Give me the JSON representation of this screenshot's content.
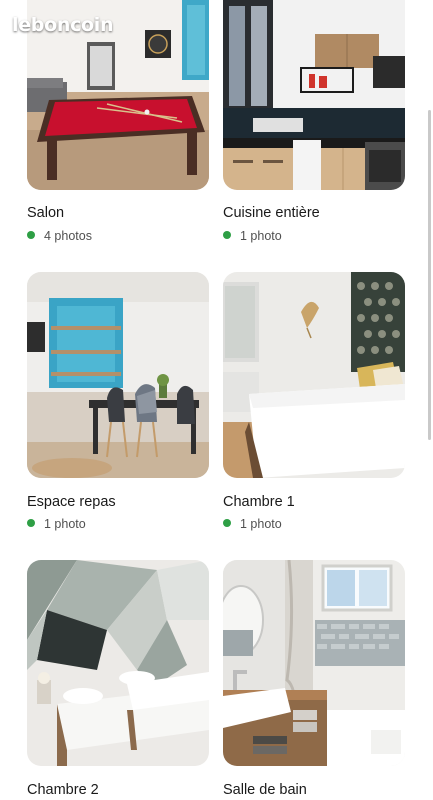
{
  "watermark": {
    "text": "leboncoin"
  },
  "colors": {
    "status_dot": "#2e9f45"
  },
  "rooms": [
    {
      "title": "Salon",
      "count": "4 photos"
    },
    {
      "title": "Cuisine entière",
      "count": "1 photo"
    },
    {
      "title": "Espace repas",
      "count": "1 photo"
    },
    {
      "title": "Chambre 1",
      "count": "1 photo"
    },
    {
      "title": "Chambre 2",
      "count": ""
    },
    {
      "title": "Salle de bain",
      "count": ""
    }
  ]
}
